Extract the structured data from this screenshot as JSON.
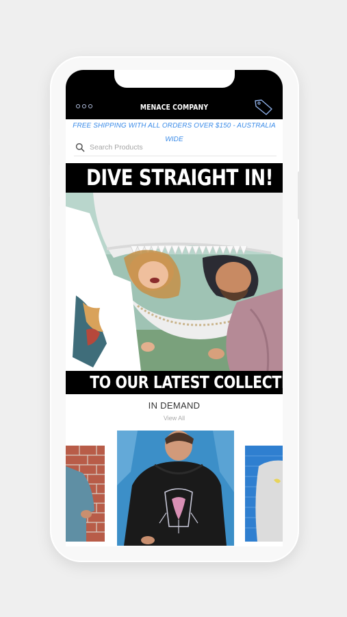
{
  "header": {
    "brand": "MENACE COMPANY",
    "menu_icon": "more-dots-icon",
    "tag_icon": "price-tag-icon"
  },
  "announcement": {
    "text": "FREE SHIPPING WITH ALL ORDERS OVER $150 - AUSTRALIA WIDE"
  },
  "search": {
    "icon": "search-icon",
    "placeholder": "Search Products"
  },
  "hero": {
    "headline_top": "DIVE STRAIGHT IN!",
    "headline_bottom": "TO OUR LATEST COLLECTION"
  },
  "collection": {
    "title": "IN DEMAND",
    "view_all": "View All"
  },
  "colors": {
    "accent": "#3a8be8",
    "header_bg": "#000000"
  }
}
